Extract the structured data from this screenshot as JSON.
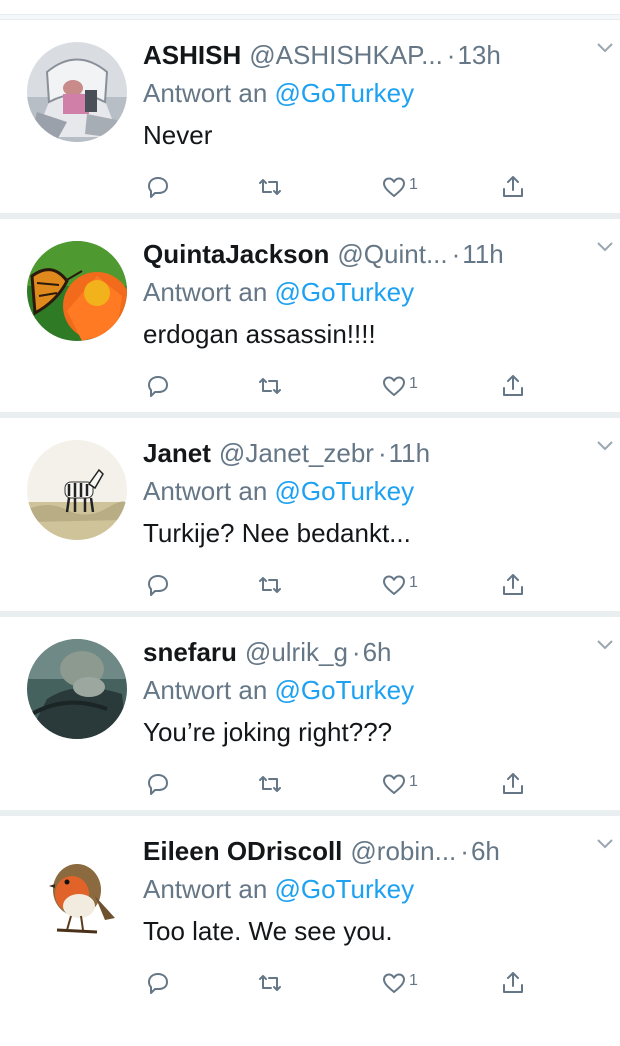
{
  "tweets": [
    {
      "name": "ASHISH",
      "handle": "@ASHISHKAP...",
      "separator": "·",
      "time": "13h",
      "reply_label": "Antwort an",
      "reply_to": "@GoTurkey",
      "text": "Never",
      "like_count": "1",
      "avatar": "avatar-ashish"
    },
    {
      "name": "QuintaJackson",
      "handle": "@Quint...",
      "separator": "·",
      "time": "11h",
      "reply_label": "Antwort an",
      "reply_to": "@GoTurkey",
      "text": "erdogan assassin!!!!",
      "like_count": "1",
      "avatar": "avatar-butterfly"
    },
    {
      "name": "Janet",
      "handle": "@Janet_zebr",
      "separator": "·",
      "time": "11h",
      "reply_label": "Antwort an",
      "reply_to": "@GoTurkey",
      "text": "Turkije? Nee bedankt...",
      "like_count": "1",
      "avatar": "avatar-zebra"
    },
    {
      "name": "snefaru",
      "handle": "@ulrik_g",
      "separator": "·",
      "time": "6h",
      "reply_label": "Antwort an",
      "reply_to": "@GoTurkey",
      "text": "You’re joking right???",
      "like_count": "1",
      "avatar": "avatar-monkey"
    },
    {
      "name": "Eileen ODriscoll",
      "handle": "@robin...",
      "separator": "·",
      "time": "6h",
      "reply_label": "Antwort an",
      "reply_to": "@GoTurkey",
      "text": "Too late. We see you.",
      "like_count": "1",
      "avatar": "avatar-robin"
    }
  ],
  "icons": {
    "reply": "reply-icon",
    "retweet": "retweet-icon",
    "like": "heart-icon",
    "share": "share-icon",
    "menu": "chevron-down-icon"
  },
  "colors": {
    "name": "#14171a",
    "meta": "#657786",
    "mention": "#1da1f2",
    "divider": "#e9eef1"
  }
}
